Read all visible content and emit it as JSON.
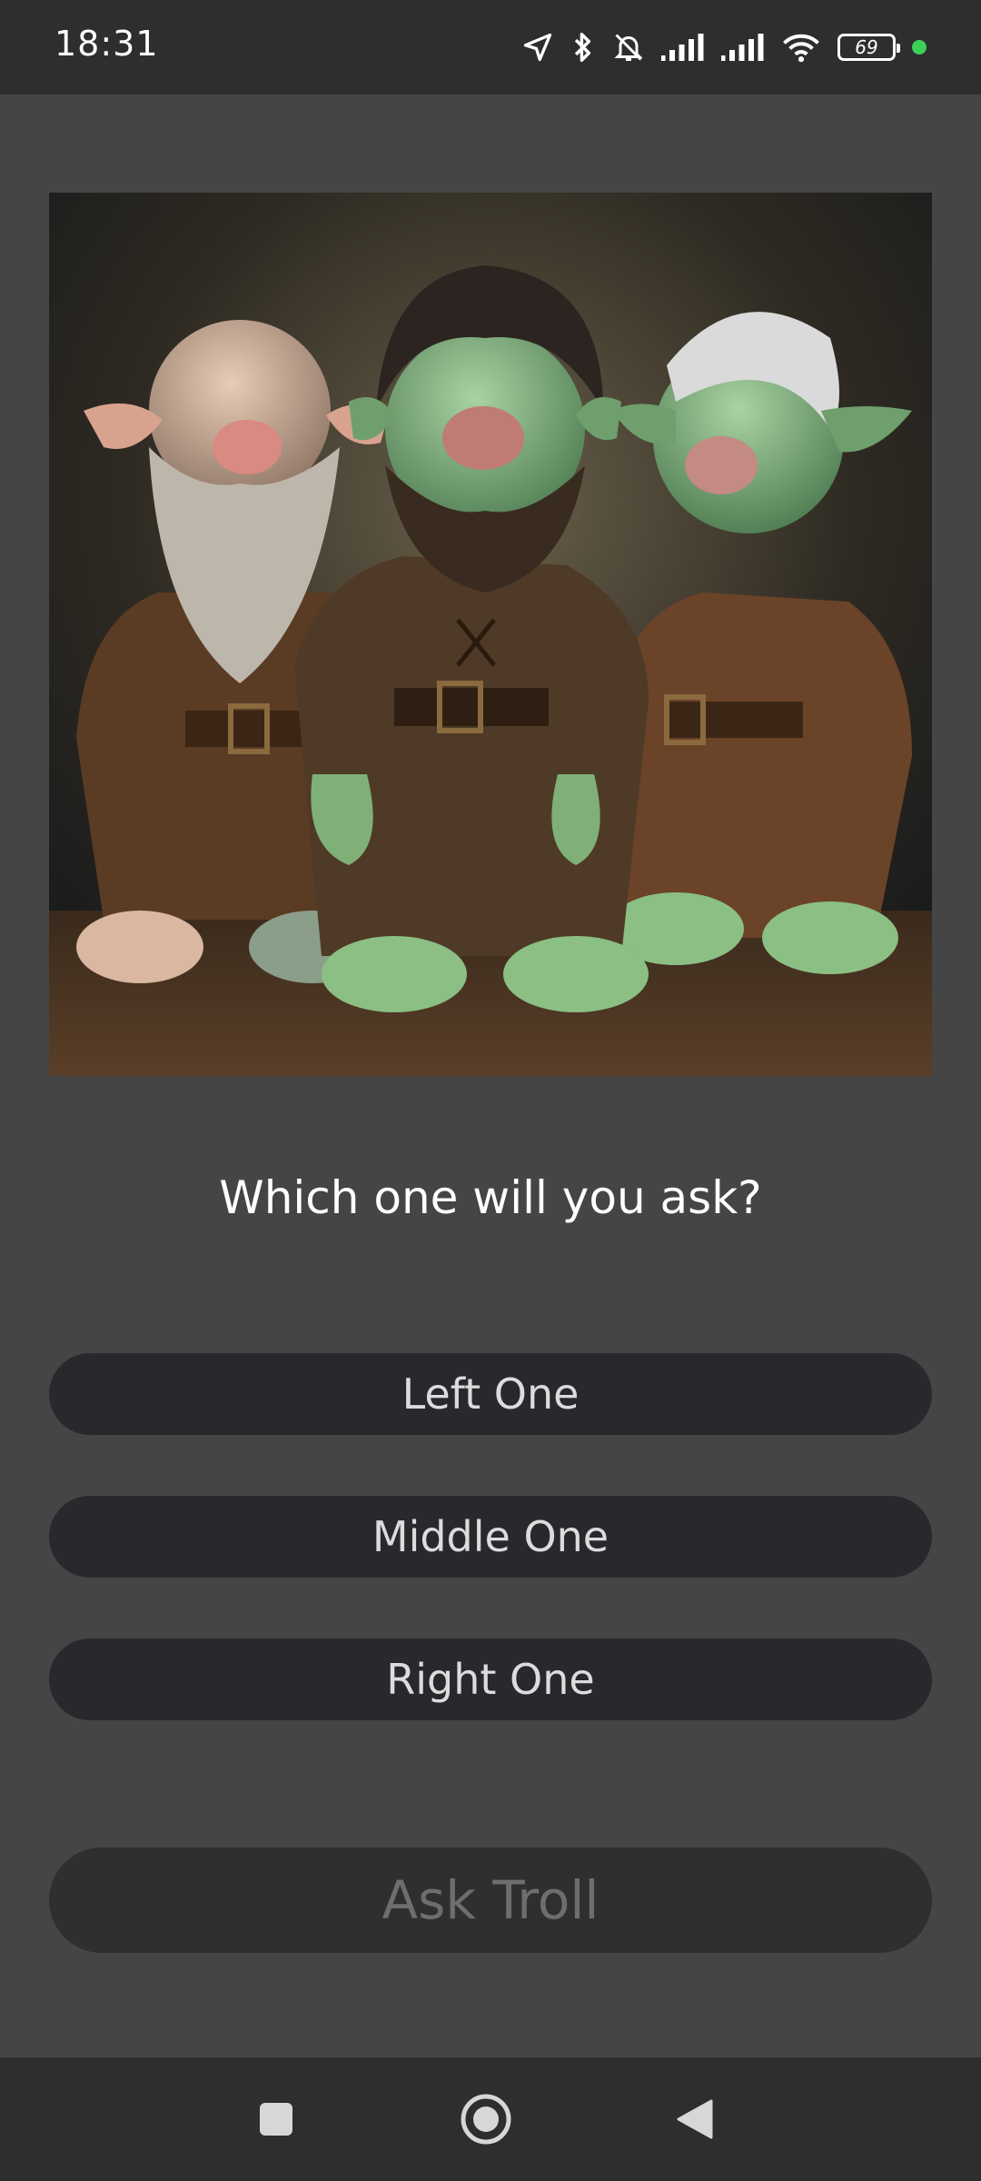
{
  "status_bar": {
    "time": "18:31",
    "battery": "69",
    "icons": [
      "location-icon",
      "bluetooth-icon",
      "bell-muted-icon",
      "signal-icon",
      "signal-icon",
      "wifi-icon",
      "battery-icon"
    ],
    "dot_color": "#3ccf5a"
  },
  "main": {
    "image_alt": "Three trolls standing side by side",
    "question": "Which one will you ask?",
    "options": [
      {
        "label": "Left One"
      },
      {
        "label": "Middle One"
      },
      {
        "label": "Right One"
      }
    ],
    "ask_label": "Ask Troll"
  },
  "nav_bar": {
    "icons": [
      "recents-square-icon",
      "home-circle-icon",
      "back-triangle-icon"
    ]
  },
  "colors": {
    "background": "#454545",
    "bar": "#2e2e2e",
    "option_button": "#29282d",
    "ask_button": "#2f2f2f",
    "ask_text": "#6e6e6e"
  }
}
